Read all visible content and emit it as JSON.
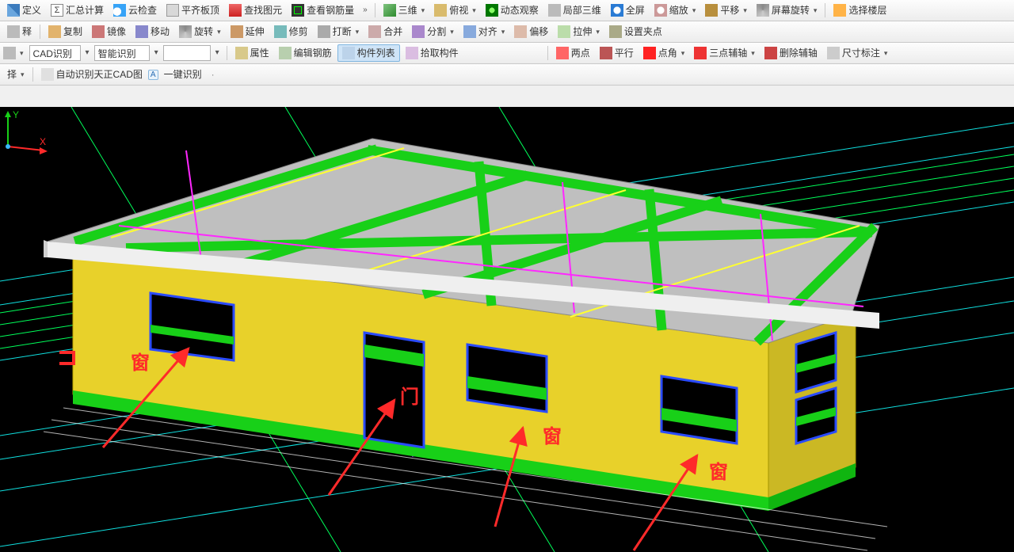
{
  "tb1": {
    "define": "定义",
    "sumcalc": "汇总计算",
    "cloud": "云检查",
    "flat": "平齐板顶",
    "find": "查找图元",
    "rebarqty": "查看钢筋量",
    "view3d": "三维",
    "top": "俯视",
    "dyn": "动态观察",
    "local3d": "局部三维",
    "full": "全屏",
    "zoom": "缩放",
    "pan": "平移",
    "screenrot": "屏幕旋转",
    "selectfloor": "选择楼层"
  },
  "tb2": {
    "sel": "释",
    "copy": "复制",
    "mirror": "镜像",
    "move": "移动",
    "rotate": "旋转",
    "extend": "延伸",
    "trim": "修剪",
    "break": "打断",
    "merge": "合并",
    "split": "分割",
    "align": "对齐",
    "offset": "偏移",
    "stretch": "拉伸",
    "grip": "设置夹点"
  },
  "tb3": {
    "cad": "CAD识别",
    "smart": "智能识别",
    "prop": "属性",
    "editrebar": "编辑钢筋",
    "list": "构件列表",
    "pick": "拾取构件",
    "twopt": "两点",
    "parallel": "平行",
    "ptang": "点角",
    "threeax": "三点辅轴",
    "delax": "删除辅轴",
    "dim": "尺寸标注"
  },
  "tb4": {
    "sel": "择",
    "auto": "自动识别天正CAD图",
    "oneclick": "一键识别",
    "dot": "·"
  },
  "anno": {
    "window": "窗",
    "door": "门"
  },
  "gizmo": {
    "y": "Y",
    "x": "X"
  }
}
